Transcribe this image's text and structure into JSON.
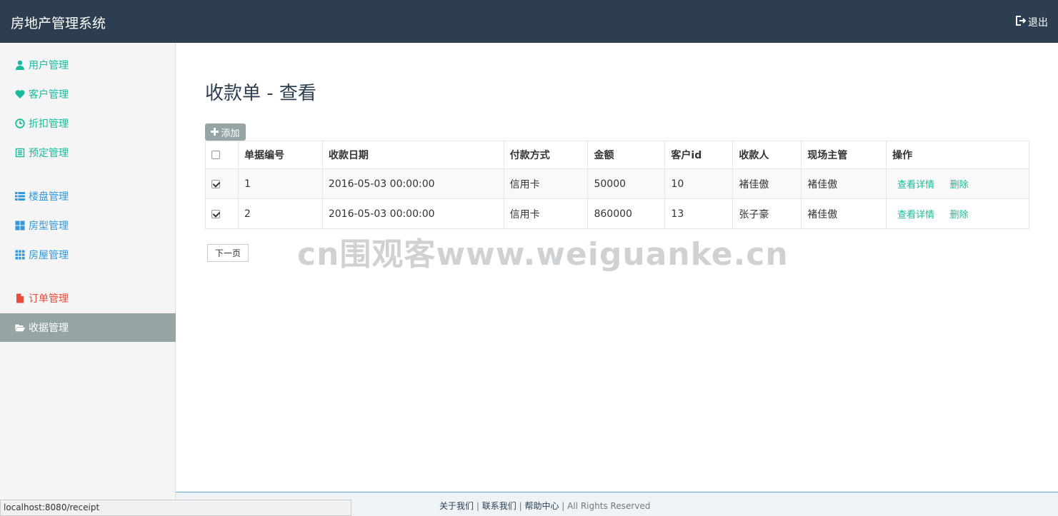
{
  "header": {
    "brand": "房地产管理系统",
    "logout_label": "退出"
  },
  "sidebar": {
    "items": [
      {
        "label": "用户管理",
        "icon": "user-icon",
        "color": "#18bc9c"
      },
      {
        "label": "客户管理",
        "icon": "heart-icon",
        "color": "#18bc9c"
      },
      {
        "label": "折扣管理",
        "icon": "clock-icon",
        "color": "#18bc9c"
      },
      {
        "label": "预定管理",
        "icon": "list-alt-icon",
        "color": "#18bc9c"
      },
      {
        "label": "楼盘管理",
        "icon": "th-list-icon",
        "color": "#3498db"
      },
      {
        "label": "房型管理",
        "icon": "th-large-icon",
        "color": "#3498db"
      },
      {
        "label": "房屋管理",
        "icon": "th-icon",
        "color": "#3498db"
      },
      {
        "label": "订单管理",
        "icon": "file-icon",
        "color": "#e74c3c"
      },
      {
        "label": "收据管理",
        "icon": "folder-open-icon",
        "color": "#ffffff",
        "active": true
      }
    ]
  },
  "main": {
    "title": "收款单 - 查看",
    "add_label": "添加",
    "next_page_label": "下一页",
    "table": {
      "columns": [
        "单据编号",
        "收款日期",
        "付款方式",
        "金额",
        "客户id",
        "收款人",
        "现场主管",
        "操作"
      ],
      "rows": [
        {
          "checked": true,
          "id": "1",
          "date": "2016-05-03 00:00:00",
          "method": "信用卡",
          "amount": "50000",
          "customer_id": "10",
          "payee": "褚佳傲",
          "supervisor": "褚佳傲"
        },
        {
          "checked": true,
          "id": "2",
          "date": "2016-05-03 00:00:00",
          "method": "信用卡",
          "amount": "860000",
          "customer_id": "13",
          "payee": "张子豪",
          "supervisor": "褚佳傲"
        }
      ],
      "actions": {
        "view": "查看详情",
        "delete": "删除"
      }
    }
  },
  "watermark": "cn围观客www.weiguanke.cn",
  "footer": {
    "about": "关于我们",
    "contact": "联系我们",
    "help": "帮助中心",
    "rights": "All Rights Reserved",
    "separator": "|"
  },
  "status_bar": {
    "url": "localhost:8080/receipt"
  },
  "colors": {
    "header_bg": "#2c3e50",
    "accent_green": "#18bc9c",
    "accent_blue": "#3498db",
    "accent_red": "#e74c3c",
    "active_item_bg": "#95a5a6"
  }
}
